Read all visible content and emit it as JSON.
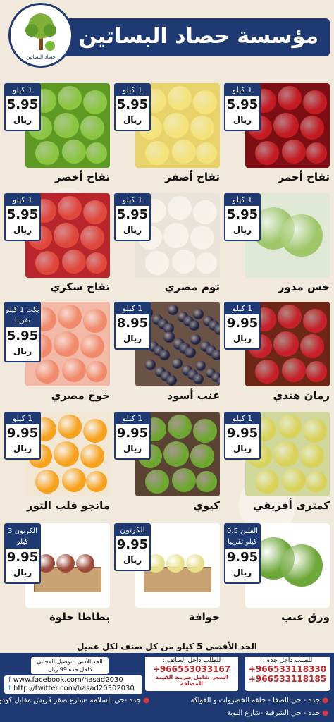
{
  "header": {
    "title": "مؤسسة حصاد البساتين"
  },
  "logo": {
    "text": "حصاد البساتين"
  },
  "products": [
    {
      "name": "تفاح أحمر",
      "unit": "1 كيلو",
      "price": "5.95",
      "currency": "ريال",
      "fruit": "red-apple"
    },
    {
      "name": "تفاح أصفر",
      "unit": "1 كيلو",
      "price": "5.95",
      "currency": "ريال",
      "fruit": "yellow-apple"
    },
    {
      "name": "تفاح أخضر",
      "unit": "1 كيلو",
      "price": "5.95",
      "currency": "ريال",
      "fruit": "green-apple"
    },
    {
      "name": "خس مدور",
      "unit": "1 كيلو",
      "price": "5.95",
      "currency": "ريال",
      "fruit": "lettuce"
    },
    {
      "name": "ثوم مصري",
      "unit": "1 كيلو",
      "price": "5.95",
      "currency": "ريال",
      "fruit": "garlic"
    },
    {
      "name": "تفاح سكري",
      "unit": "1 كيلو",
      "price": "5.95",
      "currency": "ريال",
      "fruit": "sweet-apple"
    },
    {
      "name": "رمان هندي",
      "unit": "1 كيلو",
      "price": "9.95",
      "currency": "ريال",
      "fruit": "pomegranate"
    },
    {
      "name": "عنب أسود",
      "unit": "1 كيلو",
      "price": "8.95",
      "currency": "ريال",
      "fruit": "black-grapes"
    },
    {
      "name": "خوخ مصري",
      "unit": "بكت 1 كيلو تقريبا",
      "price": "5.95",
      "currency": "ريال",
      "fruit": "peach"
    },
    {
      "name": "كمثرى أفريقي",
      "unit": "1 كيلو",
      "price": "9.95",
      "currency": "ريال",
      "fruit": "pear"
    },
    {
      "name": "كيوي",
      "unit": "1 كيلو",
      "price": "9.95",
      "currency": "ريال",
      "fruit": "kiwi"
    },
    {
      "name": "مانجو قلب الثور",
      "unit": "1 كيلو",
      "price": "9.95",
      "currency": "ريال",
      "fruit": "mango"
    },
    {
      "name": "ورق عنب",
      "unit": "الفلين 0.5 كيلو تقريبا",
      "price": "9.95",
      "currency": "ريال",
      "fruit": "grape-leaves"
    },
    {
      "name": "جوافة",
      "unit": "الكرتون",
      "price": "9.95",
      "currency": "ريال",
      "fruit": "guava"
    },
    {
      "name": "بطاطا حلوة",
      "unit": "الكرتون 3 كيلو",
      "price": "9.95",
      "currency": "ريال",
      "fruit": "sweet-potato"
    }
  ],
  "limit_text": "الحد الأقصى 5 كيلو من كل صنف لكل عميل",
  "footer": {
    "jeddah_title": "للطلب داخل جده :",
    "jeddah_phone_1": "+966533118330",
    "jeddah_phone_2": "+966533118185",
    "taif_title": "للطلب داخل الطائف :",
    "taif_phone": "+966553033167",
    "taif_note": "السعر شامل ضريبة القيمة المضافة",
    "delivery_note": "الحد الأدنى للتوصيل المجاني داخل جده 99 ريال",
    "facebook": "www.facebook.com/hasad2030",
    "twitter": "http://twitter.com/hasad20302030",
    "address_1": "جده - حي الصفا - حلقة الخضروات و الفواكه",
    "address_2": "جده -حي السلامة -شارع صقر قريش مقابل كودو",
    "address_3": "جده - حي الشرفية -شارع النوبة"
  },
  "colors": {
    "brand_blue": "#1f3a73",
    "background": "#f1e9dc",
    "phone_red": "#c0262a"
  }
}
